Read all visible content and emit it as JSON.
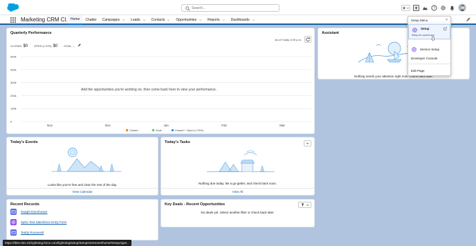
{
  "header": {
    "search_placeholder": "Search...",
    "brand_color": "#00a1e0"
  },
  "nav": {
    "app_name": "Marketing CRM Cl...",
    "items": [
      {
        "label": "Home",
        "active": true,
        "dropdown": false
      },
      {
        "label": "Chatter",
        "active": false,
        "dropdown": false
      },
      {
        "label": "Campaigns",
        "active": false,
        "dropdown": true
      },
      {
        "label": "Leads",
        "active": false,
        "dropdown": true
      },
      {
        "label": "Contacts",
        "active": false,
        "dropdown": true
      },
      {
        "label": "Opportunities",
        "active": false,
        "dropdown": true
      },
      {
        "label": "Reports",
        "active": false,
        "dropdown": true
      },
      {
        "label": "Dashboards",
        "active": false,
        "dropdown": true
      }
    ]
  },
  "quarterly": {
    "title": "Quarterly Performance",
    "as_of": "As of Today 4:09 p.m.",
    "closed_label": "CLOSED",
    "closed_value": "$0",
    "open_label": "OPEN (>70%)",
    "open_value": "$0",
    "goal_label": "GOAL",
    "goal_value": "--",
    "empty_message": "Add the opportunities you're working on, then come back here to view your performance."
  },
  "chart_data": {
    "type": "line",
    "categories": [
      "Nov",
      "Dec",
      "Jan",
      "Feb",
      "Mar"
    ],
    "y_ticks": [
      "500k",
      "400k",
      "300k",
      "200k",
      "100k",
      "0"
    ],
    "ylim": [
      0,
      500000
    ],
    "series": [
      {
        "name": "Closed",
        "color": "#f38303",
        "values": []
      },
      {
        "name": "Goal",
        "color": "#4bca81",
        "values": []
      },
      {
        "name": "Closed + Open (>70%)",
        "color": "#1b96ff",
        "values": []
      }
    ],
    "grid": true,
    "legend": "bottom"
  },
  "assistant": {
    "title": "Assistant",
    "message": "Nothing needs your attention right now. Check back later."
  },
  "events": {
    "title": "Today's Events",
    "message": "Looks like you're free and clear the rest of the day.",
    "footer": "View Calendar"
  },
  "tasks": {
    "title": "Today's Tasks",
    "message": "Nothing due today. Be a go-getter, and check back soon.",
    "footer": "View All"
  },
  "recent": {
    "title": "Recent Records",
    "items": [
      {
        "label": "Dwight Eisenhower",
        "icon": "contact-icon",
        "color": "#5867e8"
      },
      {
        "label": "Splsc Test Salesforce Entry Form",
        "icon": "form-icon",
        "color": "#9050e9"
      },
      {
        "label": "Teddy Roosevelt",
        "icon": "contact-icon",
        "color": "#5867e8"
      }
    ]
  },
  "deals": {
    "title": "Key Deals - Recent Opportunities",
    "message": "No deals yet. Select another filter or check back later."
  },
  "setup_menu": {
    "title": "Setup Menu",
    "items": [
      {
        "label": "Setup",
        "sub": "Setup for current app"
      },
      {
        "label": "Service Setup"
      },
      {
        "label": "Developer Console"
      },
      {
        "label": "Edit Page"
      }
    ]
  },
  "status_url": "https://tbits-dev-ed.lightning.force.com/lightning/setup/SetupOneHome/home#setupApps..."
}
